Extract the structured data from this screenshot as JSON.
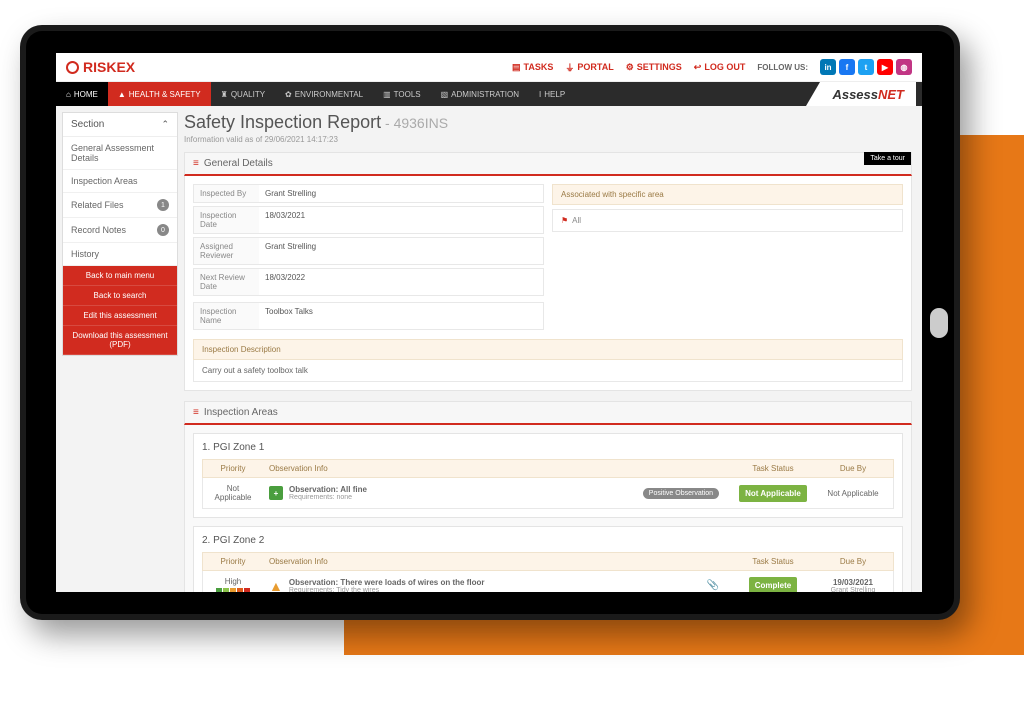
{
  "brand": "RISKEX",
  "topLinks": {
    "tasks": "TASKS",
    "portal": "PORTAL",
    "settings": "SETTINGS",
    "logout": "LOG OUT",
    "follow": "FOLLOW US:"
  },
  "nav": {
    "home": "HOME",
    "hs": "HEALTH & SAFETY",
    "quality": "QUALITY",
    "env": "ENVIRONMENTAL",
    "tools": "TOOLS",
    "admin": "ADMINISTRATION",
    "help": "HELP",
    "assessnetA": "Assess",
    "assessnetB": "NET"
  },
  "sidebar": {
    "header": "Section",
    "items": [
      "General Assessment Details",
      "Inspection Areas",
      "Related Files",
      "Record Notes",
      "History"
    ],
    "badges": {
      "files": "1",
      "notes": "0"
    },
    "actions": [
      "Back to main menu",
      "Back to search",
      "Edit this assessment",
      "Download this assessment (PDF)"
    ]
  },
  "page": {
    "title": "Safety Inspection Report",
    "code": " - 4936INS",
    "sub": "Information valid as of 29/06/2021 14:17:23"
  },
  "general": {
    "header": "General Details",
    "tour": "Take a tour",
    "rows": [
      {
        "l": "Inspected By",
        "v": "Grant Strelling"
      },
      {
        "l": "Inspection Date",
        "v": "18/03/2021"
      },
      {
        "l": "Assigned Reviewer",
        "v": "Grant Strelling"
      },
      {
        "l": "Next Review Date",
        "v": "18/03/2022"
      }
    ],
    "nameL": "Inspection Name",
    "nameV": "Toolbox Talks",
    "assocHdr": "Associated with specific area",
    "assocVal": "All",
    "descHdr": "Inspection Description",
    "descVal": "Carry out a safety toolbox talk"
  },
  "areas": {
    "header": "Inspection Areas",
    "cols": {
      "pri": "Priority",
      "obs": "Observation Info",
      "stat": "Task Status",
      "due": "Due By"
    },
    "zones": [
      {
        "title": "1. PGI Zone 1",
        "priority": "Not Applicable",
        "obsTitle": "Observation: All fine",
        "obsReq": "Requirements: none",
        "badge": "Positive Observation",
        "status": "Not Applicable",
        "due": "Not Applicable"
      },
      {
        "title": "2. PGI Zone 2",
        "priority": "High",
        "obsTitle": "Observation: There were loads of wires on the floor",
        "obsReq": "Requirements: Tidy the wires",
        "status": "Complete",
        "due": "19/03/2021",
        "dueWho": "Grant Strelling"
      }
    ]
  }
}
